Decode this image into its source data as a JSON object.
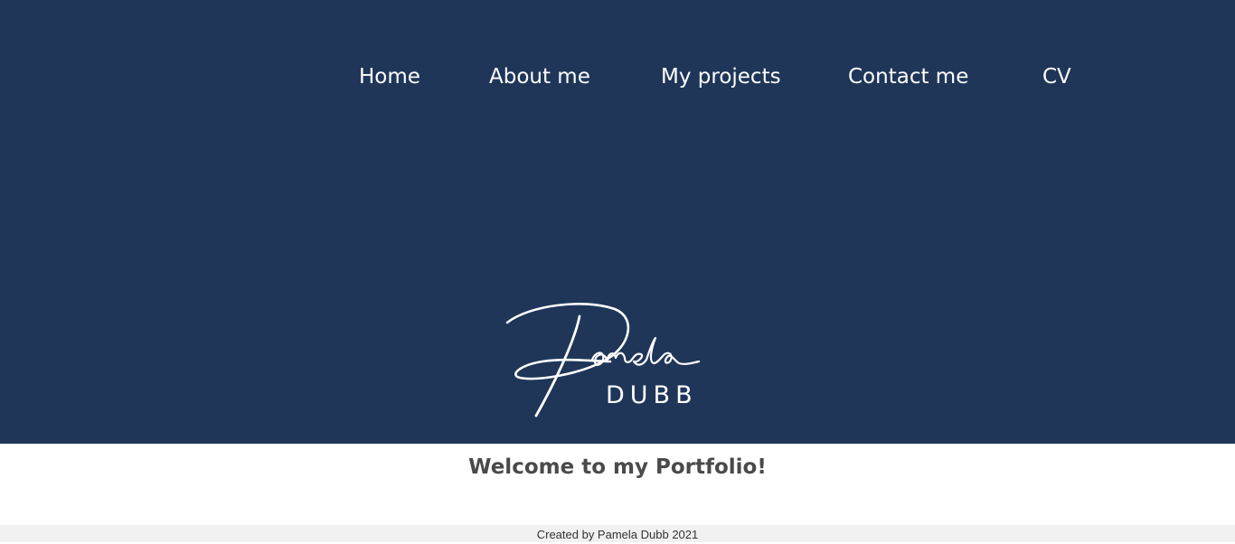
{
  "nav": {
    "items": [
      {
        "label": "Home"
      },
      {
        "label": "About me"
      },
      {
        "label": "My projects"
      },
      {
        "label": "Contact me"
      },
      {
        "label": "CV"
      }
    ]
  },
  "logo": {
    "script_text": "Pamela",
    "subtitle": "DUBB"
  },
  "main": {
    "welcome": "Welcome to my Portfolio!"
  },
  "footer": {
    "text": "Created by Pamela Dubb 2021"
  },
  "colors": {
    "hero_background": "#1f3659",
    "nav_text": "#ffffff",
    "welcome_text": "#4a4a4a",
    "footer_background": "#f1f1f1"
  }
}
